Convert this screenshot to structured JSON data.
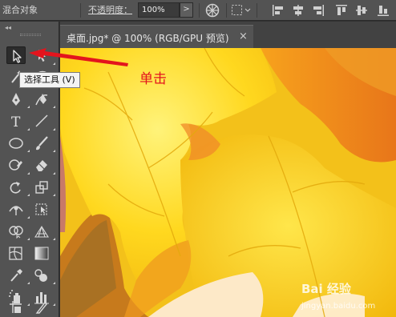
{
  "control_bar": {
    "blend_label": "混合对象",
    "opacity_label": "不透明度：",
    "opacity_value": "100%",
    "opacity_arrow": ">"
  },
  "document": {
    "tab_title": "桌面.jpg* @ 100% (RGB/GPU 预览)",
    "close_glyph": "×"
  },
  "toolbar": {
    "collapse_glyph": "◂◂",
    "type_tool_glyph": "T",
    "tools": [
      "selection-tool",
      "direct-selection-tool",
      "magic-wand-tool",
      "lasso-tool",
      "pen-tool",
      "curvature-tool",
      "type-tool",
      "line-segment-tool",
      "ellipse-tool",
      "paintbrush-tool",
      "shaper-tool",
      "eraser-tool",
      "rotate-tool",
      "scale-tool",
      "width-tool",
      "free-transform-tool",
      "shape-builder-tool",
      "perspective-grid-tool",
      "mesh-tool",
      "gradient-tool",
      "eyedropper-tool",
      "blend-tool",
      "symbol-sprayer-tool",
      "column-graph-tool",
      "artboard-tool",
      "slice-tool"
    ]
  },
  "tooltip": {
    "text": "选择工具 (V)"
  },
  "annotation": {
    "text": "单击",
    "color": "#e3141d"
  },
  "watermark": {
    "text": "Bai 经验",
    "sub": "jingyan.baidu.com"
  },
  "colors": {
    "ui_bg": "#535353",
    "canvas_yellow": "#ffd21e",
    "leaf_orange": "#ea8a1a"
  }
}
